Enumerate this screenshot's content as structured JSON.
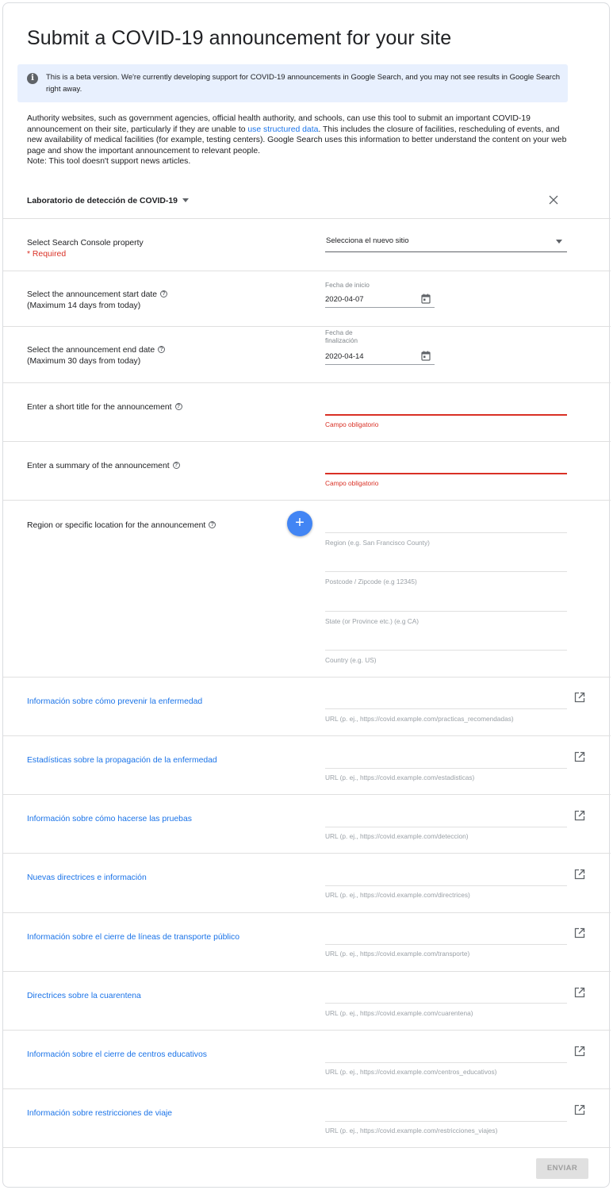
{
  "title": "Submit a COVID-19 announcement for your site",
  "beta_banner": {
    "icon": "info-icon",
    "text": "This is a beta version. We're currently developing support for COVID-19 announcements in Google Search, and you may not see results in Google Search right away."
  },
  "intro": {
    "line1_before_link": "Authority websites, such as government agencies, official health authority, and schools, can use this tool to submit an important COVID-19 announcement on their site, particularly if they are unable to ",
    "link": "use structured data",
    "line1_after_link": ". This includes the closure of facilities, rescheduling of events, and new availability of medical facilities (for example, testing centers). Google Search uses this information to better understand the content on your web page and show the important announcement to relevant people.",
    "note": "Note: This tool doesn't support news articles."
  },
  "header": {
    "dropdown_label": "Laboratorio de detección de COVID-19",
    "close_icon": "close-icon"
  },
  "property": {
    "label": "Select Search Console property",
    "required": "* Required",
    "selected": "Selecciona el nuevo sitio"
  },
  "start_date": {
    "label_line1": "Select the announcement start date",
    "label_line2": "(Maximum 14 days from today)",
    "float_label": "Fecha de inicio",
    "value": "2020-04-07"
  },
  "end_date": {
    "label_line1": "Select the announcement end date",
    "label_line2": "(Maximum 30 days from today)",
    "float_label_line1": "Fecha de",
    "float_label_line2": "finalización",
    "value": "2020-04-14"
  },
  "short_title": {
    "label": "Enter a short title for the announcement",
    "error": "Campo obligatorio"
  },
  "summary": {
    "label": "Enter a summary of the announcement",
    "error": "Campo obligatorio"
  },
  "region": {
    "label": "Region or specific location for the announcement",
    "add_icon": "+",
    "fields": [
      "Region (e.g. San Francisco County)",
      "Postcode / Zipcode (e.g 12345)",
      "State (or Province etc.) (e.g CA)",
      "Country (e.g. US)"
    ]
  },
  "links": [
    {
      "label": "Información sobre cómo prevenir la enfermedad",
      "hint": "URL (p. ej., https://covid.example.com/practicas_recomendadas)"
    },
    {
      "label": "Estadísticas sobre la propagación de la enfermedad",
      "hint": "URL (p. ej., https://covid.example.com/estadisticas)"
    },
    {
      "label": "Información sobre cómo hacerse las pruebas",
      "hint": "URL (p. ej., https://covid.example.com/deteccion)"
    },
    {
      "label": "Nuevas directrices e información",
      "hint": "URL (p. ej., https://covid.example.com/directrices)"
    },
    {
      "label": "Información sobre el cierre de líneas de transporte público",
      "hint": "URL (p. ej., https://covid.example.com/transporte)"
    },
    {
      "label": "Directrices sobre la cuarentena",
      "hint": "URL (p. ej., https://covid.example.com/cuarentena)"
    },
    {
      "label": "Información sobre el cierre de centros educativos",
      "hint": "URL (p. ej., https://covid.example.com/centros_educativos)"
    },
    {
      "label": "Información sobre restricciones de viaje",
      "hint": "URL (p. ej., https://covid.example.com/restricciones_viajes)"
    }
  ],
  "submit_label": "ENVIAR",
  "colors": {
    "link": "#1a73e8",
    "error": "#d93025",
    "banner": "#e8f0fe",
    "fab": "#4285f4"
  }
}
